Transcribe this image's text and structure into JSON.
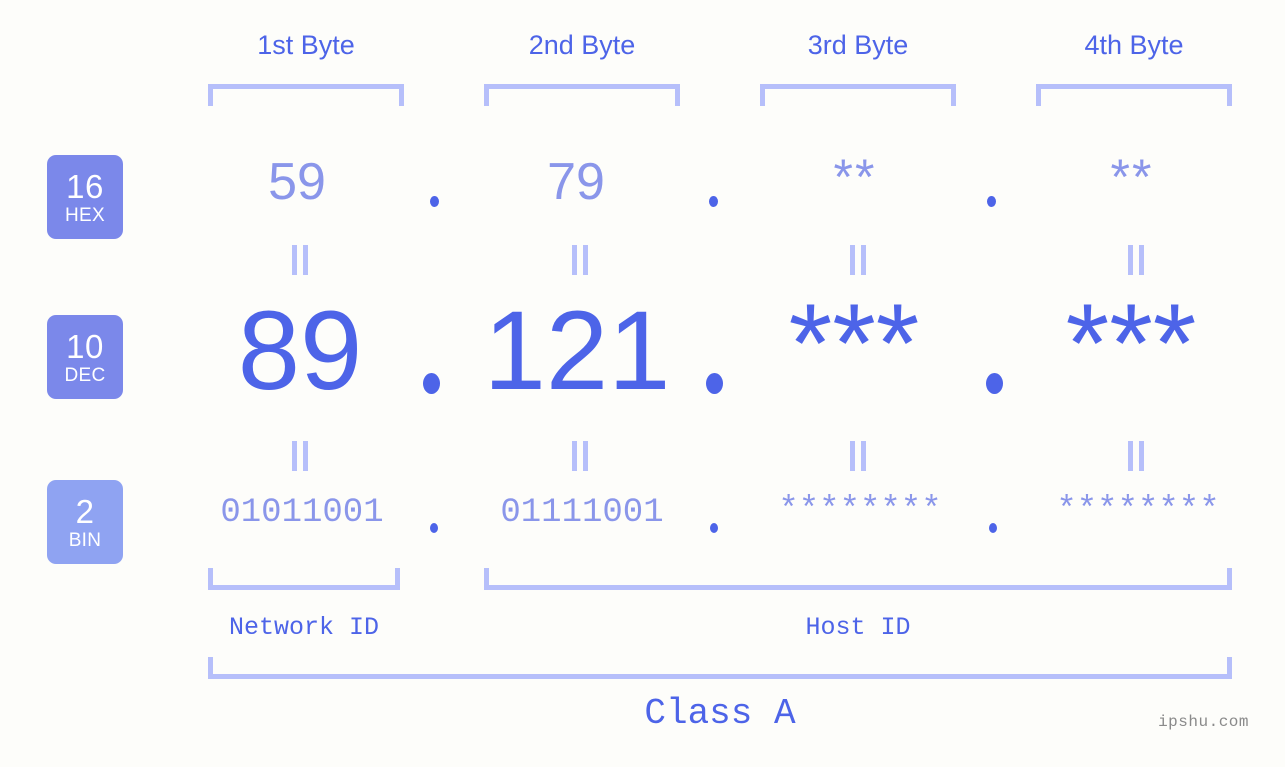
{
  "background_color": "#fdfdfa",
  "accent_color": "#4d64e8",
  "accent_light_color": "#8a96ea",
  "bracket_color": "#b6bffa",
  "byte_headers": [
    {
      "label": "1st Byte"
    },
    {
      "label": "2nd Byte"
    },
    {
      "label": "3rd Byte"
    },
    {
      "label": "4th Byte"
    }
  ],
  "radix_badges": [
    {
      "number": "16",
      "name": "HEX",
      "color": "#7b88ea"
    },
    {
      "number": "10",
      "name": "DEC",
      "color": "#7b88ea"
    },
    {
      "number": "2",
      "name": "BIN",
      "color": "#8fa3f2"
    }
  ],
  "rows": {
    "hex": {
      "values": [
        "59",
        "79",
        "**",
        "**"
      ],
      "separator": "."
    },
    "dec": {
      "values": [
        "89",
        "121",
        "***",
        "***"
      ],
      "separator": "."
    },
    "bin": {
      "values": [
        "01011001",
        "01111001",
        "********",
        "********"
      ],
      "separator": "."
    }
  },
  "equality_symbol": "=",
  "id_labels": {
    "network": "Network ID",
    "host": "Host ID"
  },
  "class_label": "Class A",
  "watermark": "ipshu.com"
}
